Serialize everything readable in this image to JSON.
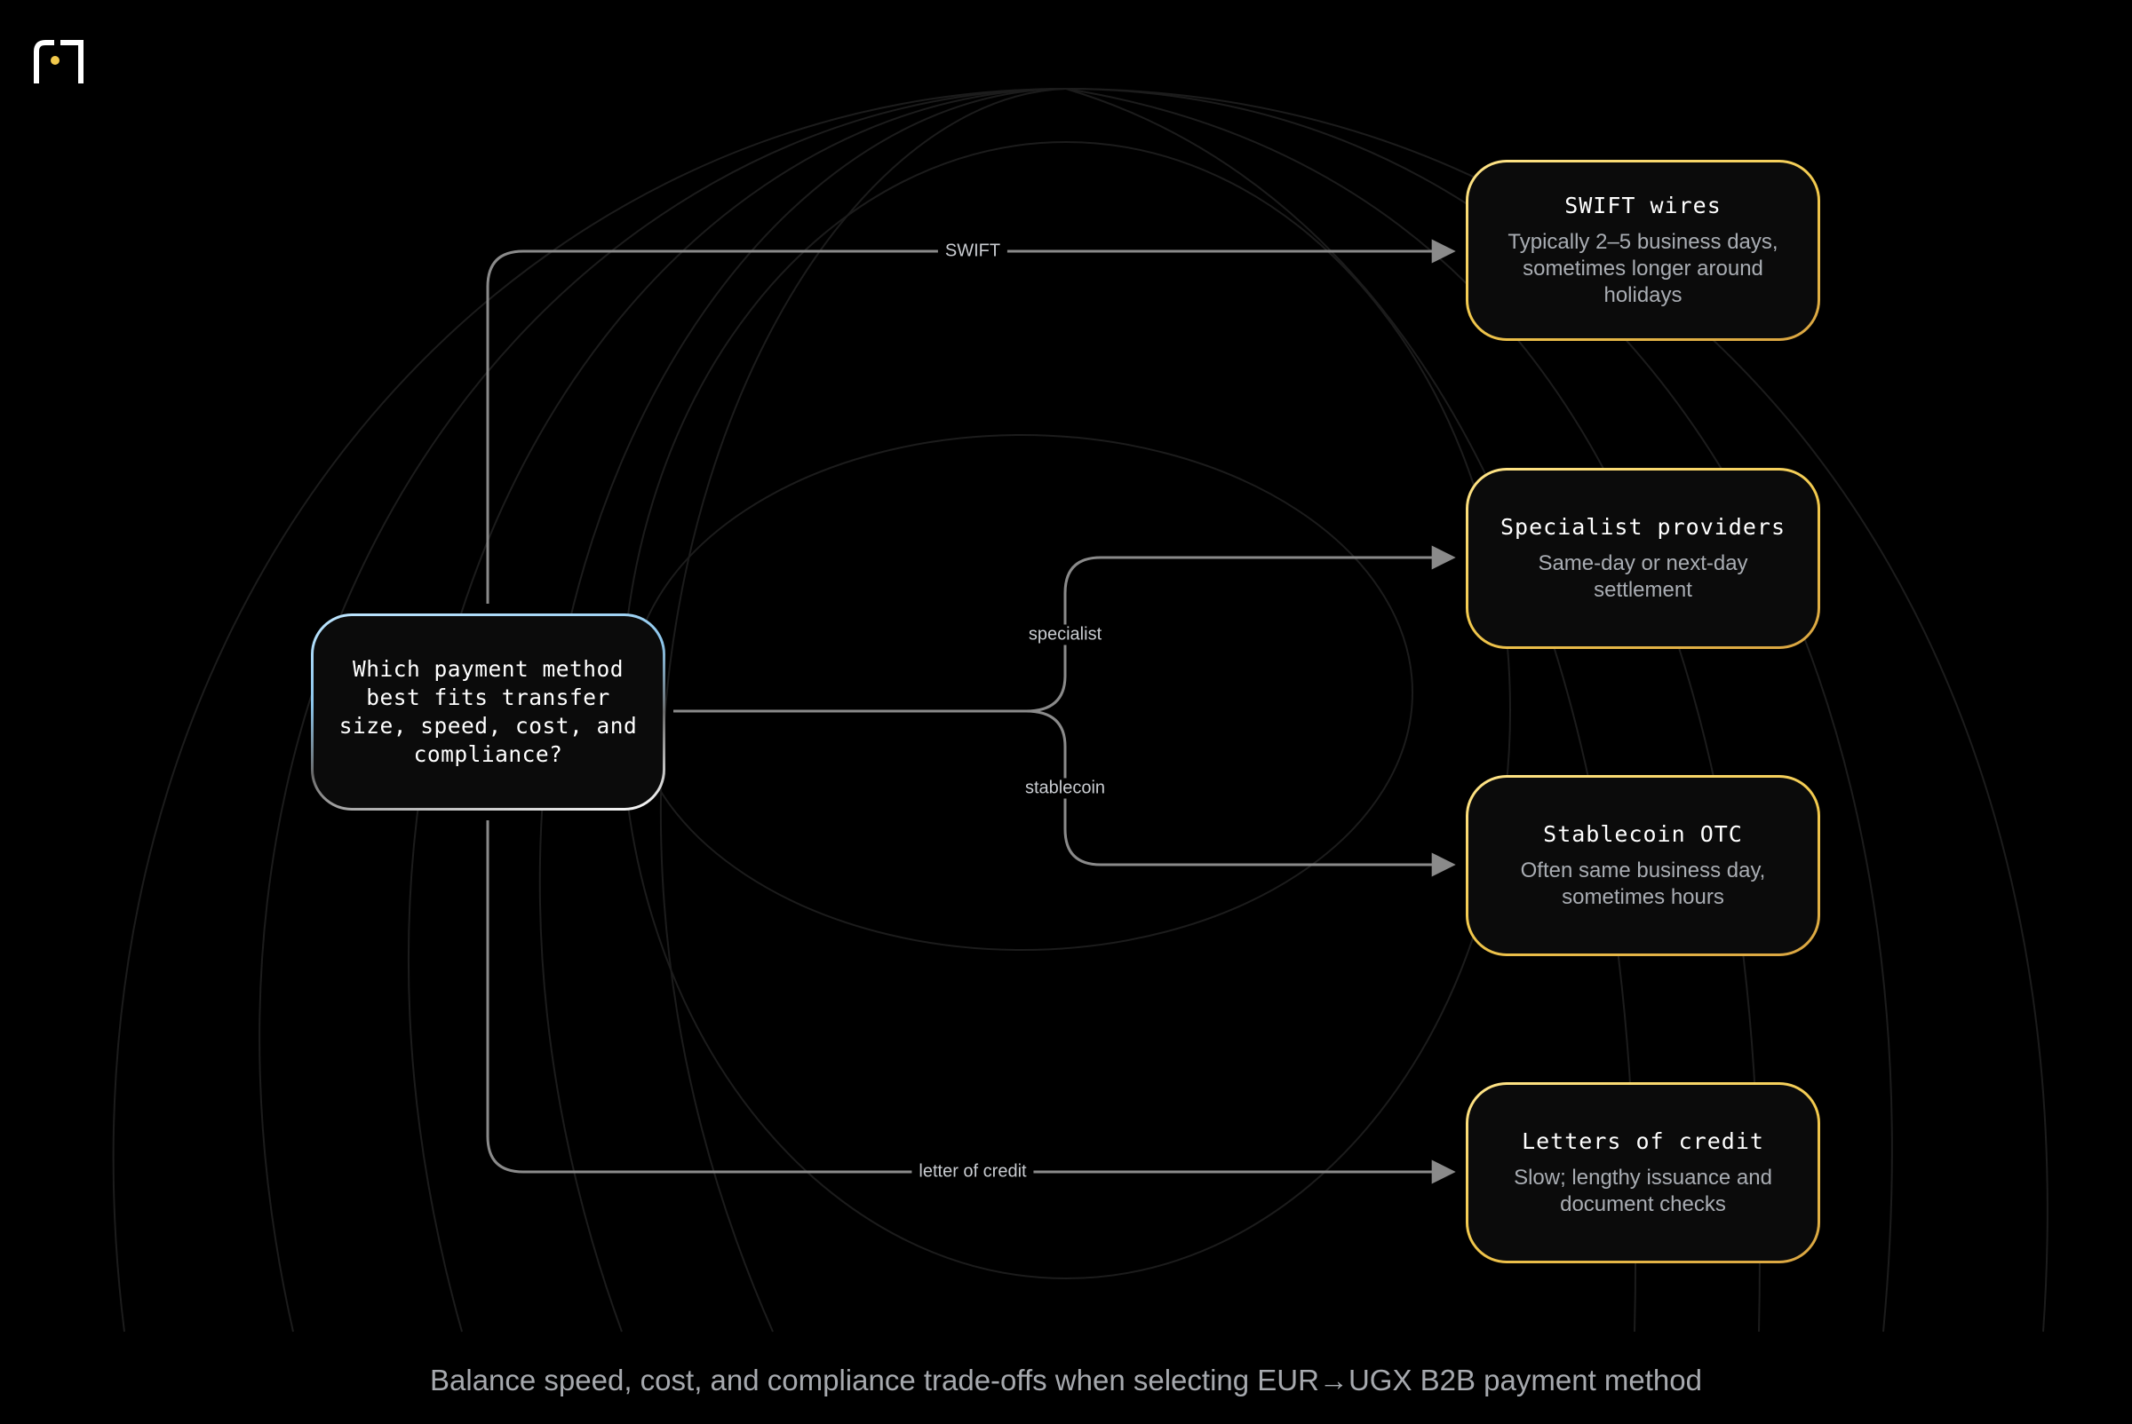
{
  "diagram": {
    "decision": {
      "text": "Which payment method best fits transfer size, speed, cost, and compliance?"
    },
    "edges": {
      "swift": "SWIFT",
      "specialist": "specialist",
      "stablecoin": "stablecoin",
      "loc": "letter of credit"
    },
    "outcomes": [
      {
        "title": "SWIFT wires",
        "desc": "Typically 2–5 business days, sometimes longer around holidays"
      },
      {
        "title": "Specialist providers",
        "desc": "Same-day or next-day settlement"
      },
      {
        "title": "Stablecoin OTC",
        "desc": "Often same business day, sometimes hours"
      },
      {
        "title": "Letters of credit",
        "desc": "Slow; lengthy issuance and document checks"
      }
    ],
    "caption": "Balance speed, cost, and compliance trade-offs when selecting EUR→UGX B2B payment method"
  },
  "colors": {
    "background": "#000000",
    "outcome_border": "#f2c94c",
    "decision_border": "#8cc6ec",
    "edge": "#8a8a8a",
    "logo_accent": "#f2c94c"
  }
}
